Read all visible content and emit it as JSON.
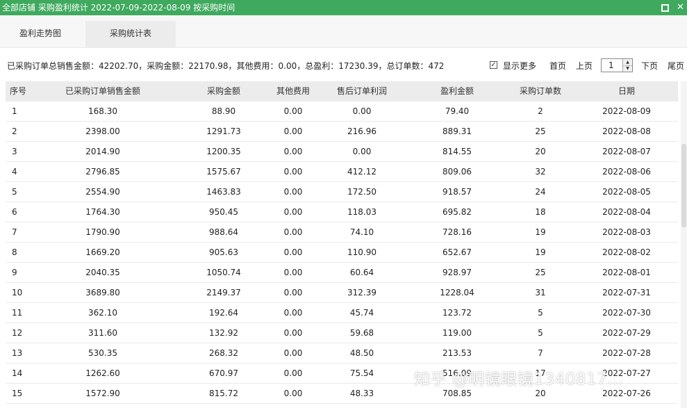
{
  "window": {
    "title": "全部店铺 采购盈利统计 2022-07-09-2022-08-09 按采购时间",
    "maximize_icon": "maximize-icon",
    "close_icon": "close-icon",
    "close_glyph": "✕"
  },
  "tabs": [
    {
      "label": "盈利走势图",
      "active": false
    },
    {
      "label": "采购统计表",
      "active": true
    }
  ],
  "summary": "已采购订单总销售金额：42202.70，采购金额：22170.98，其他费用：0.00，总盈利：17230.39，总订单数：472",
  "controls": {
    "show_more_label": "显示更多",
    "show_more_checked": true,
    "check_glyph": "✓",
    "first_page": "首页",
    "prev_page": "上页",
    "page_value": "1",
    "next_page": "下页",
    "last_page": "尾页",
    "spin_up_glyph": "▲",
    "spin_down_glyph": "▼"
  },
  "table": {
    "columns": [
      "序号",
      "已采购订单销售金额",
      "采购金额",
      "其他费用",
      "售后订单利润",
      "盈利金额",
      "采购订单数",
      "日期"
    ],
    "rows": [
      [
        "1",
        "168.30",
        "88.90",
        "0.00",
        "0.00",
        "79.40",
        "2",
        "2022-08-09"
      ],
      [
        "2",
        "2398.00",
        "1291.73",
        "0.00",
        "216.96",
        "889.31",
        "25",
        "2022-08-08"
      ],
      [
        "3",
        "2014.90",
        "1200.35",
        "0.00",
        "0.00",
        "814.55",
        "20",
        "2022-08-07"
      ],
      [
        "4",
        "2796.85",
        "1575.67",
        "0.00",
        "412.12",
        "809.06",
        "32",
        "2022-08-06"
      ],
      [
        "5",
        "2554.90",
        "1463.83",
        "0.00",
        "172.50",
        "918.57",
        "24",
        "2022-08-05"
      ],
      [
        "6",
        "1764.30",
        "950.45",
        "0.00",
        "118.03",
        "695.82",
        "18",
        "2022-08-04"
      ],
      [
        "7",
        "1790.90",
        "988.64",
        "0.00",
        "74.10",
        "728.16",
        "19",
        "2022-08-03"
      ],
      [
        "8",
        "1669.20",
        "905.63",
        "0.00",
        "110.90",
        "652.67",
        "19",
        "2022-08-02"
      ],
      [
        "9",
        "2040.35",
        "1050.74",
        "0.00",
        "60.64",
        "928.97",
        "25",
        "2022-08-01"
      ],
      [
        "10",
        "3689.80",
        "2149.37",
        "0.00",
        "312.39",
        "1228.04",
        "31",
        "2022-07-31"
      ],
      [
        "11",
        "362.10",
        "192.64",
        "0.00",
        "45.74",
        "123.72",
        "5",
        "2022-07-30"
      ],
      [
        "12",
        "311.60",
        "132.92",
        "0.00",
        "59.68",
        "119.00",
        "5",
        "2022-07-29"
      ],
      [
        "13",
        "530.35",
        "268.32",
        "0.00",
        "48.50",
        "213.53",
        "7",
        "2022-07-28"
      ],
      [
        "14",
        "1262.60",
        "670.97",
        "0.00",
        "75.54",
        "516.09",
        "17",
        "2022-07-27"
      ],
      [
        "15",
        "1572.90",
        "815.72",
        "0.00",
        "48.33",
        "708.85",
        "20",
        "2022-07-26"
      ]
    ]
  },
  "watermark": "知乎 @明镜眼镜1340817..."
}
